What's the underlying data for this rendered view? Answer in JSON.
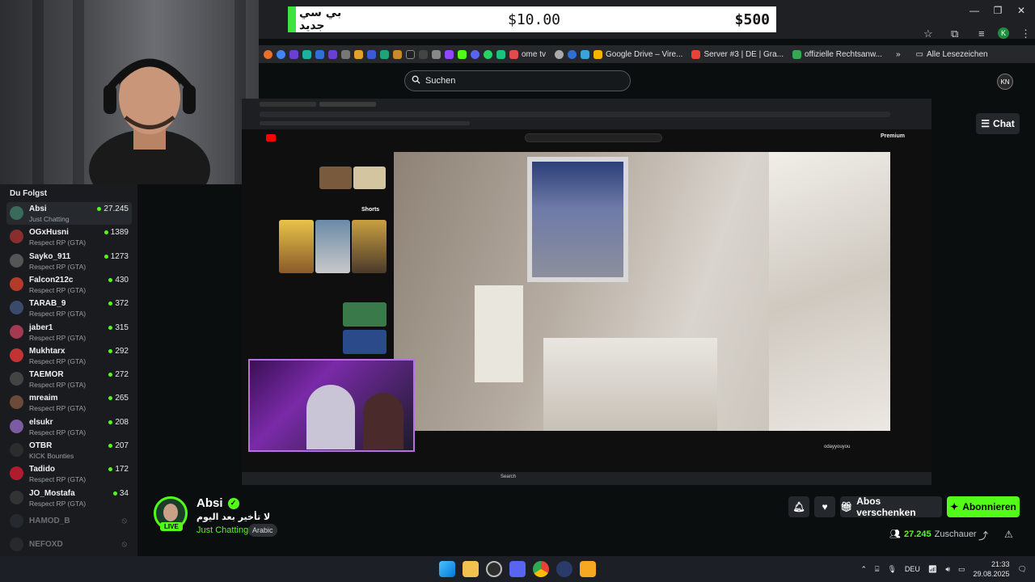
{
  "donation": {
    "name": "بي سي جديد",
    "amount_current": "$10.00",
    "amount_goal": "$500"
  },
  "bookmarks": [
    {
      "label": "ome tv",
      "color": "#e04b4b"
    },
    {
      "label": "Google Drive – Vire...",
      "color": "#f4b400"
    },
    {
      "label": "Server #3 | DE | Gra...",
      "color": "#ea4335"
    },
    {
      "label": "offizielle Rechtsanw...",
      "color": "#34a853"
    }
  ],
  "bookmarks_more": "Alle Lesezeichen",
  "search": {
    "placeholder": "Suchen"
  },
  "chat_button": "Chat",
  "sidebar": {
    "title": "Du Folgst",
    "channels": [
      {
        "name": "Absi",
        "category": "Just Chatting",
        "viewers": "27.245",
        "color": "#3a6b5a",
        "active": true
      },
      {
        "name": "OGxHusni",
        "category": "Respect RP (GTA)",
        "viewers": "1389",
        "color": "#8a2d2d"
      },
      {
        "name": "Sayko_911",
        "category": "Respect RP (GTA)",
        "viewers": "1273",
        "color": "#555"
      },
      {
        "name": "Falcon212c",
        "category": "Respect RP (GTA)",
        "viewers": "430",
        "color": "#b53a2a"
      },
      {
        "name": "TARAB_9",
        "category": "Respect RP (GTA)",
        "viewers": "372",
        "color": "#3a4a6b"
      },
      {
        "name": "jaber1",
        "category": "Respect RP (GTA)",
        "viewers": "315",
        "color": "#a33a52"
      },
      {
        "name": "Mukhtarx",
        "category": "Respect RP (GTA)",
        "viewers": "292",
        "color": "#c23333"
      },
      {
        "name": "TAEMOR",
        "category": "Respect RP (GTA)",
        "viewers": "272",
        "color": "#444"
      },
      {
        "name": "mreaim",
        "category": "Respect RP (GTA)",
        "viewers": "265",
        "color": "#6b4a3a"
      },
      {
        "name": "elsukr",
        "category": "Respect RP (GTA)",
        "viewers": "208",
        "color": "#7a5ca3"
      },
      {
        "name": "OTBR",
        "category": "KICK Bounties",
        "viewers": "207",
        "color": "#2c2c2c"
      },
      {
        "name": "Tadido",
        "category": "Respect RP (GTA)",
        "viewers": "172",
        "color": "#b01c2e"
      },
      {
        "name": "JO_Mostafa",
        "category": "Respect RP (GTA)",
        "viewers": "34",
        "color": "#333"
      }
    ],
    "offline": [
      "HAMOD_B",
      "NEFOXD"
    ]
  },
  "channel": {
    "name": "Absi",
    "live": "LIVE",
    "title": "لا تأخير بعد اليوم",
    "category": "Just Chatting",
    "tag": "Arabic",
    "viewers": "27.245",
    "viewers_label": "Zuschauer"
  },
  "actions": {
    "gift": "Abos verschenken",
    "subscribe": "Abonnieren"
  },
  "player": {
    "shorts_label": "Shorts",
    "premium": "Premium",
    "channel_handle": "odayyouyou",
    "taskbar_search": "Search"
  },
  "taskbar": {
    "lang": "DEU",
    "time": "21:33",
    "date": "29.08.2025"
  },
  "colors": {
    "kick_green": "#53fc18",
    "bg": "#0b0e0f",
    "sidebar": "#191b1f"
  }
}
